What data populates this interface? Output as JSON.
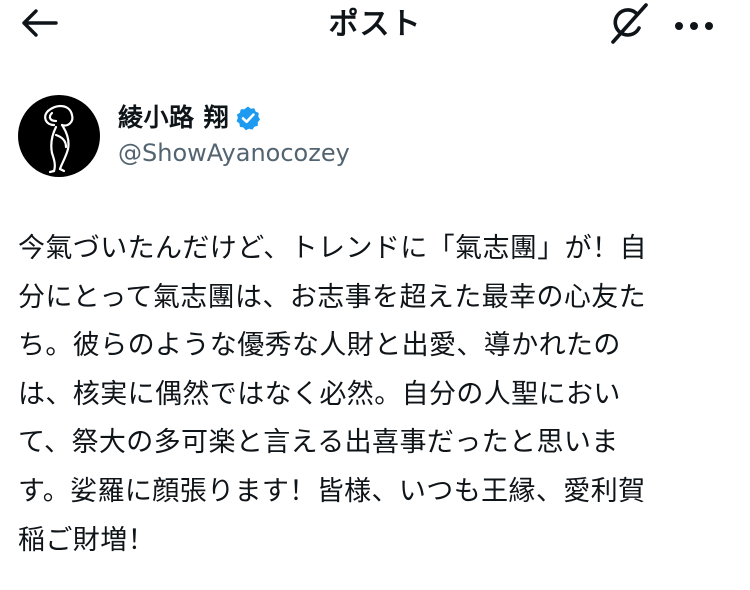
{
  "header": {
    "title": "ポスト",
    "back_icon": "back-arrow-icon",
    "grok_icon": "grok-icon",
    "more_icon": "more-icon"
  },
  "author": {
    "display_name": "綾小路 翔",
    "handle": "@ShowAyanocozey",
    "verified": true,
    "verified_color": "#1d9bf0"
  },
  "post": {
    "lines": [
      "今氣づいたんだけど、トレンドに「氣志團」が！自",
      "分にとって氣志團は、お志事を超えた最幸の心友た",
      "ち。彼らのような優秀な人財と出愛、導かれたの",
      "は、核実に偶然ではなく必然。自分の人聖におい",
      "て、祭大の多可楽と言える出喜事だったと思いま",
      "す。娑羅に顔張ります！皆様、いつも王縁、愛利賀",
      "稲ご財増！"
    ]
  },
  "colors": {
    "text": "#0f1419",
    "secondary": "#536471",
    "accent": "#1d9bf0",
    "background": "#ffffff"
  }
}
